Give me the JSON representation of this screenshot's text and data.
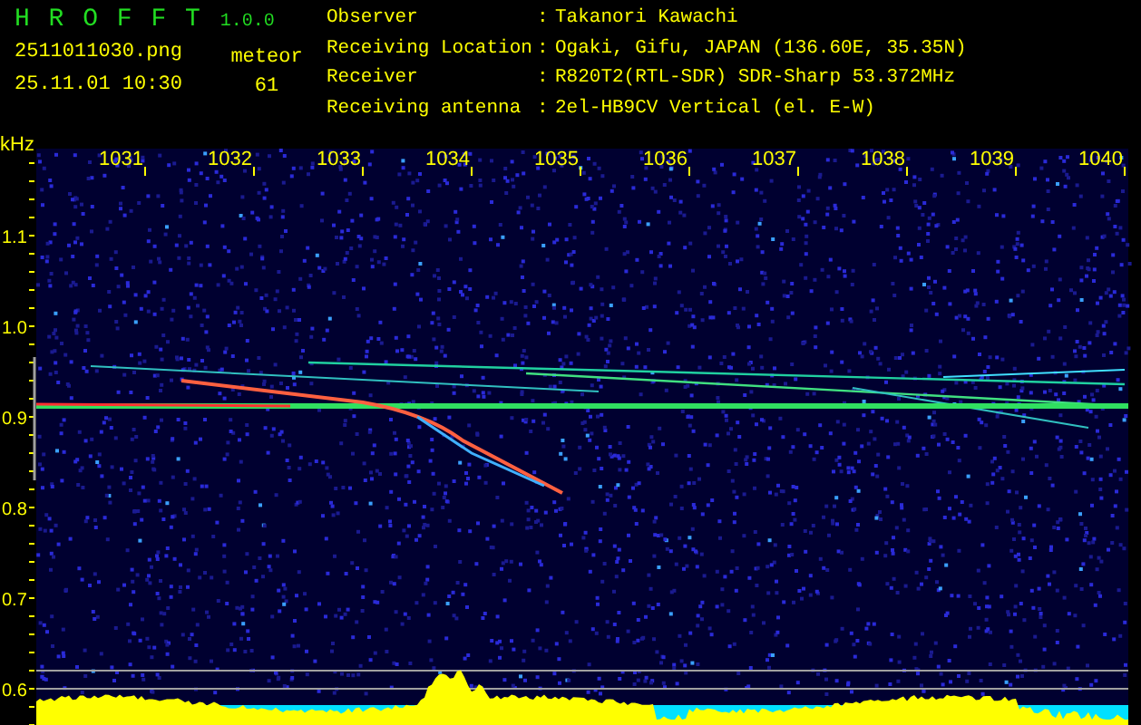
{
  "app": {
    "name": "H R O F F T",
    "version": "1.0.0"
  },
  "file": {
    "name": "2511011030.png",
    "datetime": "25.11.01 10:30"
  },
  "meteor": {
    "label": "meteor",
    "count": "61"
  },
  "info": [
    {
      "label": "Observer",
      "separator": ":",
      "value": "Takanori Kawachi"
    },
    {
      "label": "Receiving Location",
      "separator": ":",
      "value": "Ogaki, Gifu, JAPAN (136.60E, 35.35N)"
    },
    {
      "label": "Receiver",
      "separator": ":",
      "value": "R820T2(RTL-SDR) SDR-Sharp 53.372MHz"
    },
    {
      "label": "Receiving antenna",
      "separator": ":",
      "value": "2el-HB9CV Vertical (el. E-W)"
    }
  ],
  "spectrogram": {
    "unit": "kHz",
    "x_labels": [
      "1031",
      "1032",
      "1033",
      "1034",
      "1035",
      "1036",
      "1037",
      "1038",
      "1039",
      "1040"
    ],
    "y_labels": [
      "1.1",
      "1.0",
      "0.9",
      "0.8",
      "0.7",
      "0.6"
    ]
  }
}
